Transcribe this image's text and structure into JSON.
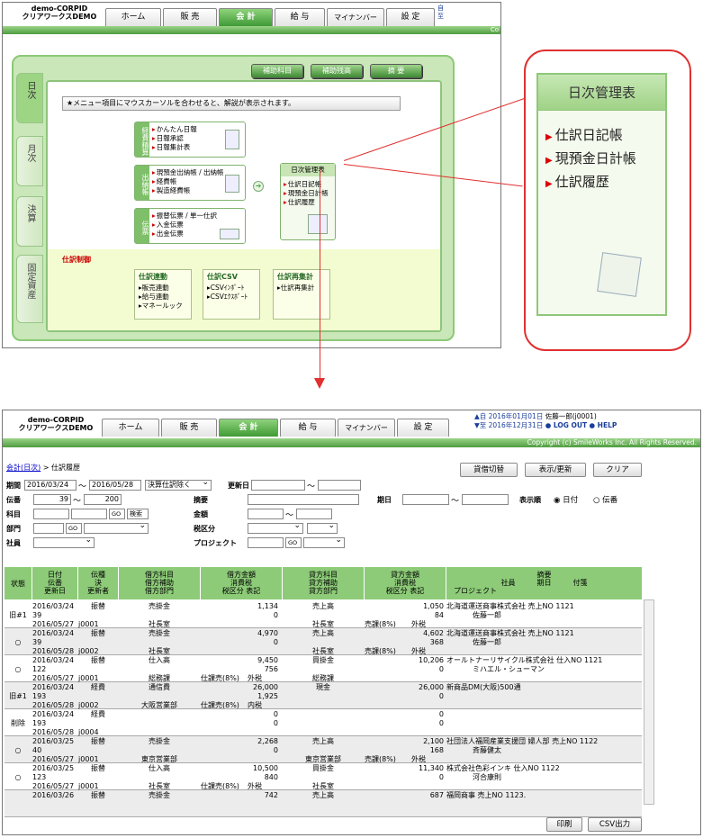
{
  "top": {
    "company": [
      "demo-CORPID",
      "クリアワークスDEMO"
    ],
    "tabs": [
      "ホーム",
      "販 売",
      "会 計",
      "給 与",
      "マイナンバー",
      "設 定"
    ],
    "corner_lines": [
      "自",
      "至"
    ],
    "corner_small": "Co",
    "side_tabs": [
      "日次",
      "月次",
      "決算",
      "固定資産"
    ],
    "top_buttons": [
      "補助科目",
      "補助残高",
      "摘 要"
    ],
    "notice": "★メニュー項目にマウスカーソルを合わせると、解説が表示されます。",
    "groups": [
      {
        "label": "経費精算",
        "items": [
          "かんたん日報",
          "日報承認",
          "日報集計表"
        ]
      },
      {
        "label": "出納帳",
        "items": [
          "現預金出納帳 / 出納帳",
          "経費帳",
          "製造経費帳"
        ]
      },
      {
        "label": "伝票",
        "items": [
          "振替伝票 / 単一仕訳",
          "入金伝票",
          "出金伝票"
        ]
      }
    ],
    "daily": {
      "title": "日次管理表",
      "items": [
        "仕訳日記帳",
        "現預金日計帳",
        "仕訳履歴"
      ]
    },
    "control_head": "仕訳制御",
    "control_groups": [
      {
        "title": "仕訳連動",
        "items": [
          "▸販売連動",
          "▸給与連動",
          "▸マネールック"
        ]
      },
      {
        "title": "仕訳CSV",
        "items": [
          "▸CSVｲﾝﾎﾟｰﾄ",
          "▸CSVｴｸｽﾎﾟｰﾄ"
        ]
      },
      {
        "title": "仕訳再集計",
        "items": [
          "▸仕訳再集計"
        ]
      }
    ]
  },
  "callout": {
    "title": "日次管理表",
    "items": [
      "仕訳日記帳",
      "現預金日計帳",
      "仕訳履歴"
    ]
  },
  "bot": {
    "company": [
      "demo-CORPID",
      "クリアワークスDEMO"
    ],
    "tabs": [
      "ホーム",
      "販 売",
      "会 計",
      "給 与",
      "マイナンバー",
      "設 定"
    ],
    "date_from": "▲自 2016年01月01日",
    "date_to": "▼至 2016年12月31日",
    "user": "佐藤一郎(j0001)",
    "logout": "● LOG OUT",
    "help": "● HELP",
    "copyright": "Copyright (c) SmileWorks Inc. All Rights Reserved.",
    "breadcrumb_link": "会計(日次)",
    "breadcrumb_rest": " > 仕訳履歴",
    "buttons": {
      "switch": "貸借切替",
      "refresh": "表示/更新",
      "clear": "クリア",
      "print": "印刷",
      "csv": "CSV出力"
    },
    "form": {
      "period_label": "期間",
      "period_from": "2016/03/24",
      "period_to": "2016/05/28",
      "period_opt": "決算仕訳除く",
      "update_label": "更新日",
      "voucher_label": "伝番",
      "voucher_from": "39",
      "voucher_to": "200",
      "summary_label": "摘要",
      "date_label": "期日",
      "order_label": "表示順",
      "order_date": "日付",
      "order_voucher": "伝番",
      "account_label": "科目",
      "go": "GO",
      "search": "検索",
      "amount_label": "金額",
      "dept_label": "部門",
      "tax_label": "税区分",
      "staff_label": "社員",
      "project_label": "プロジェクト",
      "range_sep": "～"
    },
    "headers": [
      [
        "状態"
      ],
      [
        "日付",
        "伝番",
        "更新日"
      ],
      [
        "伝種",
        "決",
        "更新者"
      ],
      [
        "借方科目",
        "借方補助",
        "借方部門"
      ],
      [
        "借方金額",
        "消費税",
        "税区分",
        "表記"
      ],
      [
        "貸方科目",
        "貸方補助",
        "貸方部門"
      ],
      [
        "貸方金額",
        "消費税",
        "税区分",
        "表記"
      ],
      [
        "摘要",
        "社員",
        "期日",
        "付箋",
        "プロジェクト"
      ]
    ],
    "rows": [
      {
        "status": "旧#1",
        "date": "2016/03/24",
        "no": "39",
        "upd": "2016/05/27",
        "kind": "振替",
        "user": "j0001",
        "dr": "売掛金",
        "drsub": "",
        "drdept": "社長室",
        "dramt": "1,134",
        "drtax": "0",
        "drtaxcls": "",
        "drmark": "",
        "cr": "売上高",
        "crdept": "社長室",
        "cramt": "1,050",
        "crtax": "84",
        "crtaxcls": "売課(8%)",
        "crmark": "外税",
        "memo": "北海道運送商事株式会社 売上NO 1121",
        "staff": "佐藤一郎"
      },
      {
        "status": "○",
        "date": "2016/03/24",
        "no": "39",
        "upd": "2016/05/28",
        "kind": "振替",
        "user": "j0002",
        "dr": "売掛金",
        "drsub": "",
        "drdept": "社長室",
        "dramt": "4,970",
        "drtax": "0",
        "drtaxcls": "",
        "drmark": "",
        "cr": "売上高",
        "crdept": "社長室",
        "cramt": "4,602",
        "crtax": "368",
        "crtaxcls": "売課(8%)",
        "crmark": "外税",
        "memo": "北海道運送商事株式会社 売上NO 1121",
        "staff": "佐藤一郎"
      },
      {
        "status": "○",
        "date": "2016/03/24",
        "no": "122",
        "upd": "2016/05/27",
        "kind": "振替",
        "user": "j0001",
        "dr": "仕入高",
        "drsub": "",
        "drdept": "総務課",
        "dramt": "9,450",
        "drtax": "756",
        "drtaxcls": "仕課売(8%)",
        "drmark": "外税",
        "cr": "買掛金",
        "crdept": "総務課",
        "cramt": "10,206",
        "crtax": "0",
        "crtaxcls": "",
        "crmark": "",
        "memo": "オールトナーリサイクル株式会社 仕入NO 1121",
        "staff": "ミハエル・シューマン"
      },
      {
        "status": "旧#1",
        "date": "2016/03/24",
        "no": "193",
        "upd": "2016/05/28",
        "kind": "経費",
        "user": "j0002",
        "dr": "通信費",
        "drsub": "",
        "drdept": "大阪営業部",
        "dramt": "26,000",
        "drtax": "1,925",
        "drtaxcls": "仕課売(8%)",
        "drmark": "内税",
        "cr": "現金",
        "crdept": "",
        "cramt": "26,000",
        "crtax": "0",
        "crtaxcls": "",
        "crmark": "",
        "memo": "新商品DM(大阪)500通",
        "staff": ""
      },
      {
        "status": "削除",
        "date": "2016/03/24",
        "no": "193",
        "upd": "2016/05/28",
        "kind": "経費",
        "user": "j0004",
        "dr": "",
        "drsub": "",
        "drdept": "",
        "dramt": "0",
        "drtax": "0",
        "drtaxcls": "",
        "drmark": "",
        "cr": "",
        "crdept": "",
        "cramt": "0",
        "crtax": "0",
        "crtaxcls": "",
        "crmark": "",
        "memo": "",
        "staff": ""
      },
      {
        "status": "○",
        "date": "2016/03/25",
        "no": "40",
        "upd": "2016/05/27",
        "kind": "振替",
        "user": "j0001",
        "dr": "売掛金",
        "drsub": "",
        "drdept": "東京営業部",
        "dramt": "2,268",
        "drtax": "0",
        "drtaxcls": "",
        "drmark": "",
        "cr": "売上高",
        "crdept": "東京営業部",
        "cramt": "2,100",
        "crtax": "168",
        "crtaxcls": "売課(8%)",
        "crmark": "外税",
        "memo": "社団法人福岡産業支援団 婦人部 売上NO 1122",
        "staff": "斉藤健太"
      },
      {
        "status": "○",
        "date": "2016/03/25",
        "no": "123",
        "upd": "2016/05/27",
        "kind": "振替",
        "user": "j0001",
        "dr": "仕入高",
        "drsub": "",
        "drdept": "社長室",
        "dramt": "10,500",
        "drtax": "840",
        "drtaxcls": "仕課売(8%)",
        "drmark": "外税",
        "cr": "買掛金",
        "crdept": "社長室",
        "cramt": "11,340",
        "crtax": "0",
        "crtaxcls": "",
        "crmark": "",
        "memo": "株式会社色彩インキ 仕入NO 1122",
        "staff": "河合康則"
      },
      {
        "status": "",
        "date": "2016/03/26",
        "no": "",
        "upd": "",
        "kind": "振替",
        "user": "",
        "dr": "売掛金",
        "drsub": "",
        "drdept": "",
        "dramt": "742",
        "drtax": "",
        "drtaxcls": "",
        "drmark": "",
        "cr": "売上高",
        "crdept": "",
        "cramt": "687",
        "crtax": "",
        "crtaxcls": "",
        "crmark": "",
        "memo": "福岡商事 売上NO 1123.",
        "staff": ""
      }
    ]
  }
}
